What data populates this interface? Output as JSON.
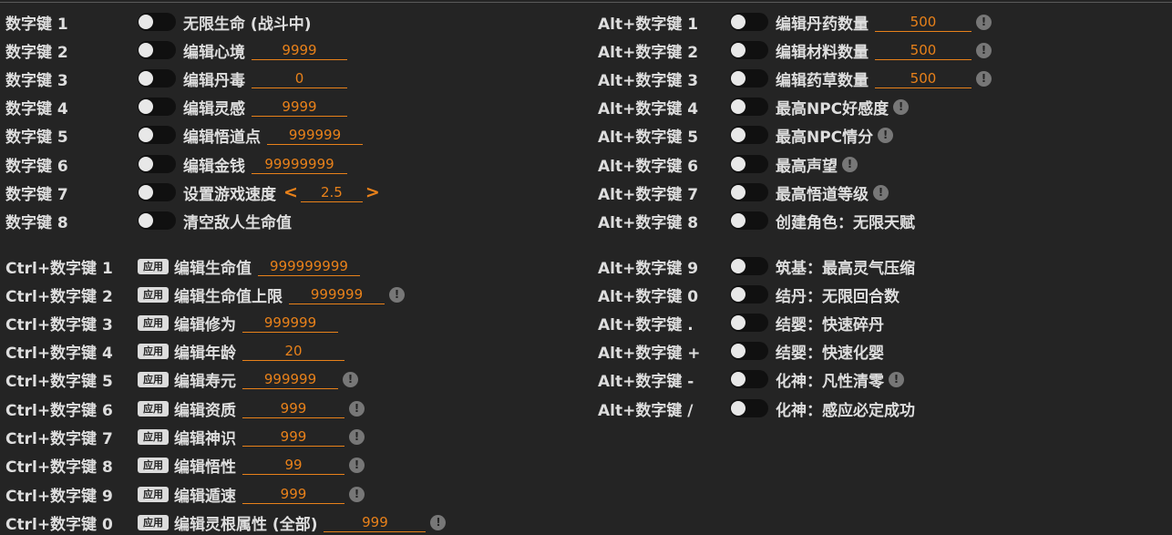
{
  "left_rows": [
    {
      "key": "数字键 1",
      "control": "toggle",
      "label": "无限生命 (战斗中)"
    },
    {
      "key": "数字键 2",
      "control": "toggle",
      "label": "编辑心境",
      "value": "9999"
    },
    {
      "key": "数字键 3",
      "control": "toggle",
      "label": "编辑丹毒",
      "value": "0"
    },
    {
      "key": "数字键 4",
      "control": "toggle",
      "label": "编辑灵感",
      "value": "9999"
    },
    {
      "key": "数字键 5",
      "control": "toggle",
      "label": "编辑悟道点",
      "value": "999999"
    },
    {
      "key": "数字键 6",
      "control": "toggle",
      "label": "编辑金钱",
      "value": "99999999"
    },
    {
      "key": "数字键 7",
      "control": "toggle",
      "label": "设置游戏速度",
      "value": "2.5",
      "arrows": true
    },
    {
      "key": "数字键 8",
      "control": "toggle",
      "label": "清空敌人生命值"
    },
    {
      "key": "Ctrl+数字键 1",
      "control": "apply",
      "label": "编辑生命值",
      "value": "999999999"
    },
    {
      "key": "Ctrl+数字键 2",
      "control": "apply",
      "label": "编辑生命值上限",
      "value": "999999",
      "info": true
    },
    {
      "key": "Ctrl+数字键 3",
      "control": "apply",
      "label": "编辑修为",
      "value": "999999"
    },
    {
      "key": "Ctrl+数字键 4",
      "control": "apply",
      "label": "编辑年龄",
      "value": "20"
    },
    {
      "key": "Ctrl+数字键 5",
      "control": "apply",
      "label": "编辑寿元",
      "value": "999999",
      "info": true
    },
    {
      "key": "Ctrl+数字键 6",
      "control": "apply",
      "label": "编辑资质",
      "value": "999",
      "info": true
    },
    {
      "key": "Ctrl+数字键 7",
      "control": "apply",
      "label": "编辑神识",
      "value": "999",
      "info": true
    },
    {
      "key": "Ctrl+数字键 8",
      "control": "apply",
      "label": "编辑悟性",
      "value": "99",
      "info": true
    },
    {
      "key": "Ctrl+数字键 9",
      "control": "apply",
      "label": "编辑遁速",
      "value": "999",
      "info": true
    },
    {
      "key": "Ctrl+数字键 0",
      "control": "apply",
      "label": "编辑灵根属性 (全部)",
      "value": "999",
      "info": true
    }
  ],
  "right_rows": [
    {
      "key": "Alt+数字键 1",
      "control": "toggle",
      "label": "编辑丹药数量",
      "value": "500",
      "info": true
    },
    {
      "key": "Alt+数字键 2",
      "control": "toggle",
      "label": "编辑材料数量",
      "value": "500",
      "info": true
    },
    {
      "key": "Alt+数字键 3",
      "control": "toggle",
      "label": "编辑药草数量",
      "value": "500",
      "info": true
    },
    {
      "key": "Alt+数字键 4",
      "control": "toggle",
      "label": "最高NPC好感度",
      "info": true
    },
    {
      "key": "Alt+数字键 5",
      "control": "toggle",
      "label": "最高NPC情分",
      "info": true
    },
    {
      "key": "Alt+数字键 6",
      "control": "toggle",
      "label": "最高声望",
      "info": true
    },
    {
      "key": "Alt+数字键 7",
      "control": "toggle",
      "label": "最高悟道等级",
      "info": true
    },
    {
      "key": "Alt+数字键 8",
      "control": "toggle",
      "label": "创建角色：无限天赋"
    },
    {
      "key": "Alt+数字键 9",
      "control": "toggle",
      "label": "筑基：最高灵气压缩"
    },
    {
      "key": "Alt+数字键 0",
      "control": "toggle",
      "label": "结丹：无限回合数"
    },
    {
      "key": "Alt+数字键 .",
      "control": "toggle",
      "label": "结婴：快速碎丹"
    },
    {
      "key": "Alt+数字键 +",
      "control": "toggle",
      "label": "结婴：快速化婴"
    },
    {
      "key": "Alt+数字键 -",
      "control": "toggle",
      "label": "化神：凡性清零",
      "info": true
    },
    {
      "key": "Alt+数字键 /",
      "control": "toggle",
      "label": "化神：感应必定成功"
    }
  ],
  "apply_label": "应用",
  "info_glyph": "!",
  "arrow_left": "<",
  "arrow_right": ">",
  "colors": {
    "accent": "#e8811a",
    "background": "#242424",
    "text": "#dedede"
  }
}
